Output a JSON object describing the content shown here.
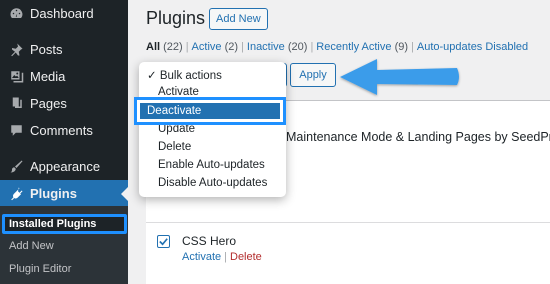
{
  "sidebar": {
    "items": [
      {
        "label": "Dashboard",
        "icon": "dashboard-icon"
      },
      {
        "label": "Posts",
        "icon": "pin-icon"
      },
      {
        "label": "Media",
        "icon": "media-icon"
      },
      {
        "label": "Pages",
        "icon": "pages-icon"
      },
      {
        "label": "Comments",
        "icon": "comment-icon"
      },
      {
        "label": "Appearance",
        "icon": "brush-icon"
      },
      {
        "label": "Plugins",
        "icon": "plug-icon"
      }
    ],
    "submenu": [
      "Installed Plugins",
      "Add New",
      "Plugin Editor"
    ]
  },
  "header": {
    "title": "Plugins",
    "add_new": "Add New"
  },
  "filters": {
    "all": "All",
    "all_count": "(22)",
    "active": "Active",
    "active_count": "(2)",
    "inactive": "Inactive",
    "inactive_count": "(20)",
    "recent": "Recently Active",
    "recent_count": "(9)",
    "autoupdates": "Auto-updates Disabled"
  },
  "bulk": {
    "apply": "Apply",
    "options": [
      "Bulk actions",
      "Activate",
      "Deactivate",
      "Update",
      "Delete",
      "Enable Auto-updates",
      "Disable Auto-updates"
    ],
    "selected": "Bulk actions",
    "highlighted": "Deactivate"
  },
  "plugins": [
    {
      "name": "Maintenance Mode & Landing Pages by SeedProd"
    },
    {
      "name": "CSS Hero",
      "activate": "Activate",
      "delete": "Delete"
    }
  ],
  "colors": {
    "accent": "#2271b1",
    "highlight": "#1e90ff",
    "sidebar": "#1d2327",
    "danger": "#b32d2e"
  }
}
